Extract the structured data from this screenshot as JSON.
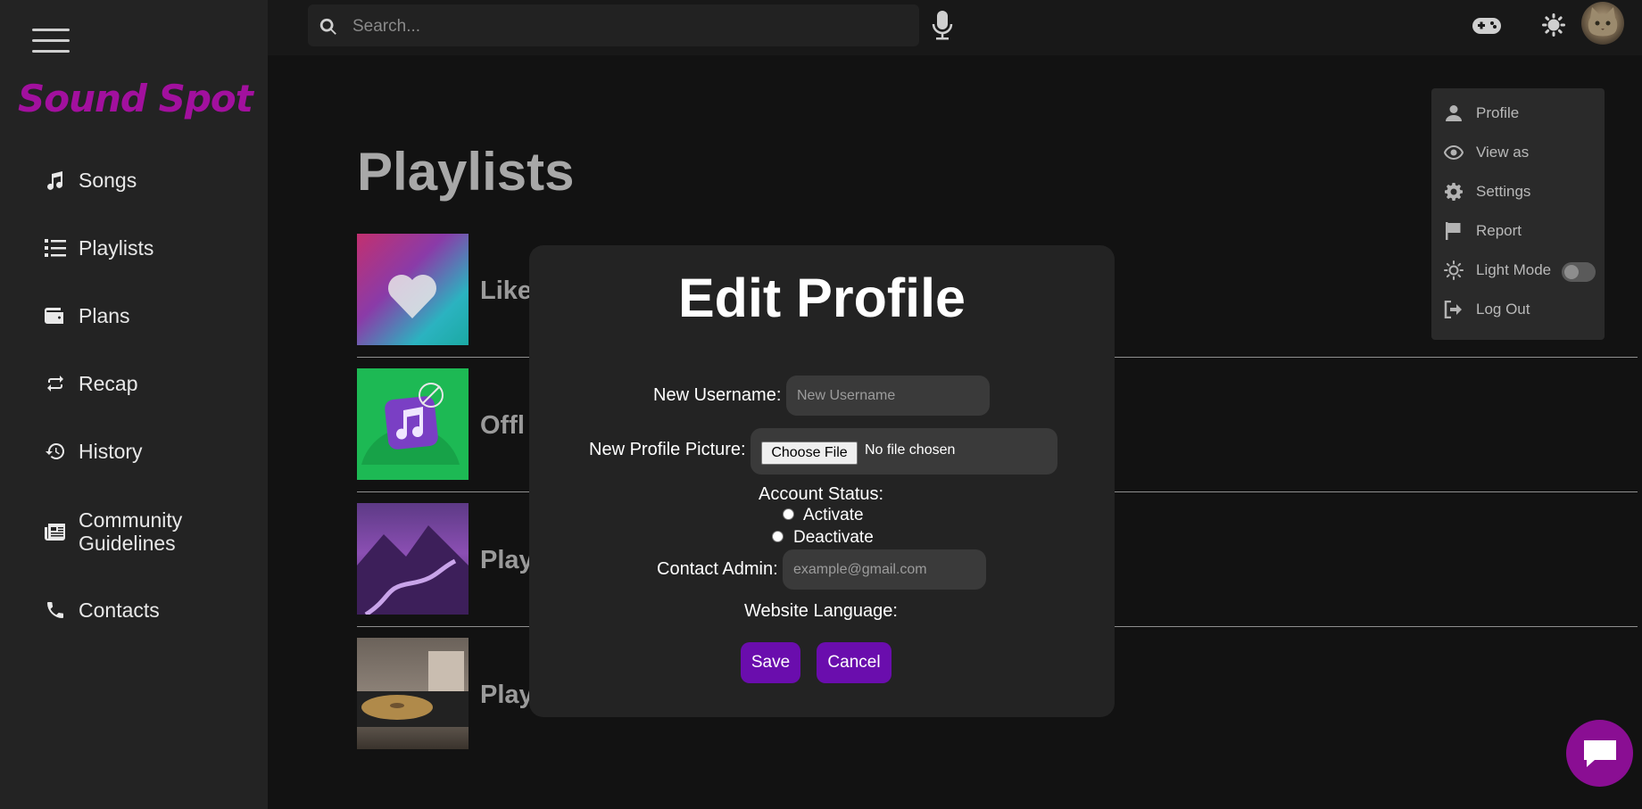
{
  "app": {
    "logo_text": "Sound Spot",
    "brand_color": "#a2109e",
    "accent_color": "#6a0dad"
  },
  "sidebar": {
    "items": [
      {
        "label": "Songs",
        "icon": "music-note-icon"
      },
      {
        "label": "Playlists",
        "icon": "list-icon"
      },
      {
        "label": "Plans",
        "icon": "wallet-icon"
      },
      {
        "label": "Recap",
        "icon": "repeat-icon"
      },
      {
        "label": "History",
        "icon": "history-icon"
      },
      {
        "label": "Community\nGuidelines",
        "label_line1": "Community",
        "label_line2": "Guidelines",
        "icon": "newspaper-icon"
      },
      {
        "label": "Contacts",
        "icon": "phone-icon"
      }
    ]
  },
  "topbar": {
    "search_placeholder": "Search...",
    "icons": [
      "search-icon",
      "microphone-icon",
      "gamepad-icon",
      "sun-icon",
      "avatar"
    ]
  },
  "main": {
    "title": "Playlists",
    "playlists": [
      {
        "name_visible": "Like",
        "thumb": "heart-gradient"
      },
      {
        "name_visible": "Offl",
        "thumb": "offline-music"
      },
      {
        "name_visible": "Play",
        "thumb": "purple-mountains"
      },
      {
        "name_visible": "Play",
        "thumb": "record-player"
      }
    ]
  },
  "dropdown": {
    "items": [
      {
        "label": "Profile",
        "icon": "user-icon"
      },
      {
        "label": "View as",
        "icon": "eye-icon"
      },
      {
        "label": "Settings",
        "icon": "gear-icon"
      },
      {
        "label": "Report",
        "icon": "flag-icon"
      },
      {
        "label": "Light Mode",
        "icon": "sun-outline-icon"
      },
      {
        "label": "Log Out",
        "icon": "logout-icon"
      }
    ],
    "light_mode_on": false
  },
  "modal": {
    "title": "Edit Profile",
    "username_label": "New Username:",
    "username_placeholder": "New Username",
    "picture_label": "New Profile Picture:",
    "file_button": "Choose File",
    "file_status": "No file chosen",
    "status_label": "Account Status:",
    "activate_label": "Activate",
    "deactivate_label": "Deactivate",
    "contact_label": "Contact Admin:",
    "contact_placeholder": "example@gmail.com",
    "language_label": "Website Language:",
    "save_label": "Save",
    "cancel_label": "Cancel"
  }
}
